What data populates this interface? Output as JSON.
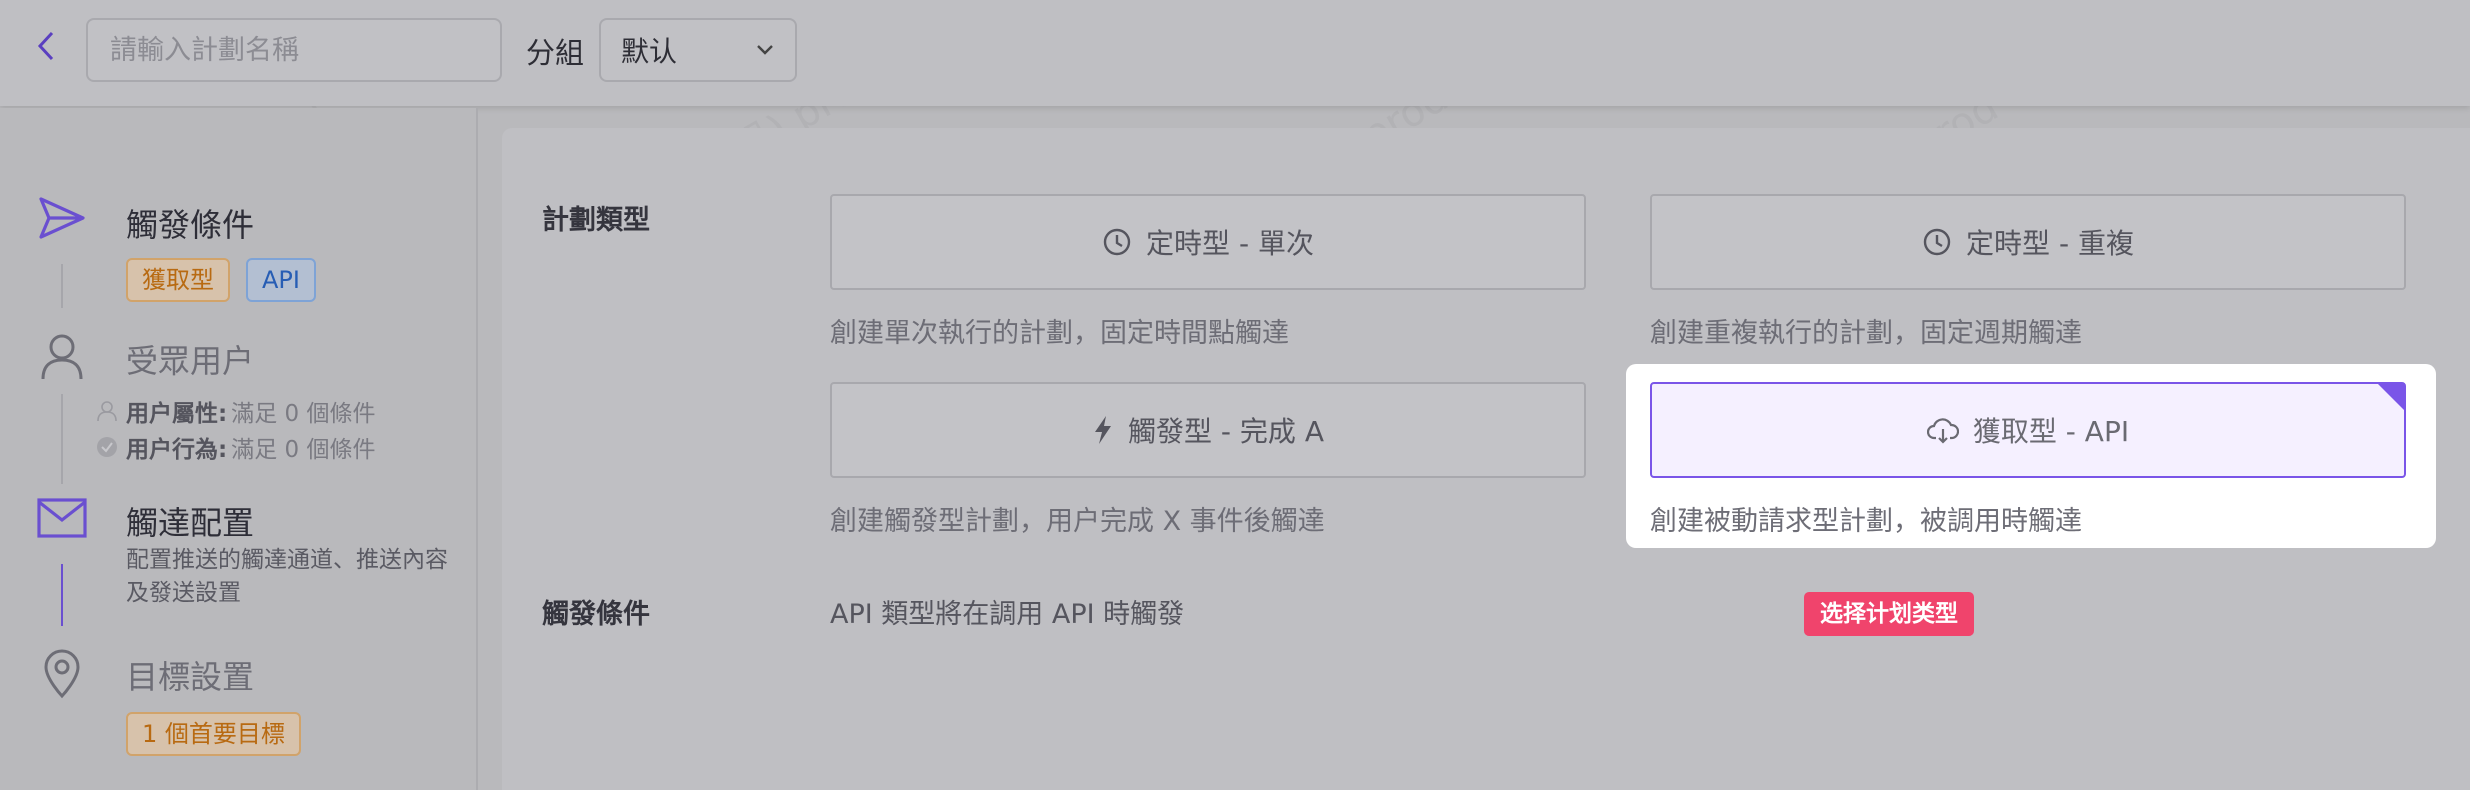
{
  "header": {
    "plan_name_placeholder": "請輸入計劃名稱",
    "group_label": "分組",
    "group_value": "默认"
  },
  "sidebar": {
    "steps": [
      {
        "title": "觸發條件",
        "tags": [
          "獲取型",
          "API"
        ]
      },
      {
        "title": "受眾用户",
        "lines": [
          {
            "key": "用户屬性:",
            "value": "滿足 0 個條件"
          },
          {
            "key": "用户行為:",
            "value": "滿足 0 個條件"
          }
        ]
      },
      {
        "title": "觸達配置",
        "desc": "配置推送的觸達通道、推送內容及發送設置"
      },
      {
        "title": "目標設置",
        "tags": [
          "1 個首要目標"
        ]
      }
    ]
  },
  "main": {
    "plan_type_label": "計劃類型",
    "cards": [
      {
        "label": "定時型 - 單次",
        "desc": "創建單次執行的計劃，固定時間點觸達",
        "icon": "clock-icon"
      },
      {
        "label": "定時型 - 重複",
        "desc": "創建重複執行的計劃，固定週期觸達",
        "icon": "clock-icon"
      },
      {
        "label": "觸發型 - 完成 A",
        "desc": "創建觸發型計劃，用户完成 X 事件後觸達",
        "icon": "lightning-icon"
      },
      {
        "label": "獲取型 - API",
        "desc": "創建被動請求型計劃，被調用時觸達",
        "icon": "cloud-download-icon",
        "selected": true
      }
    ],
    "trigger_label": "觸發條件",
    "trigger_text": "API 類型將在調用 API 時觸發"
  },
  "tooltip": {
    "text": "选择计划类型"
  },
  "watermark": "Evan(张帆) prod",
  "colors": {
    "accent": "#7a55e8",
    "tooltip": "#f0446c",
    "tag_orange": "#b86a12",
    "tag_blue": "#275db4"
  }
}
